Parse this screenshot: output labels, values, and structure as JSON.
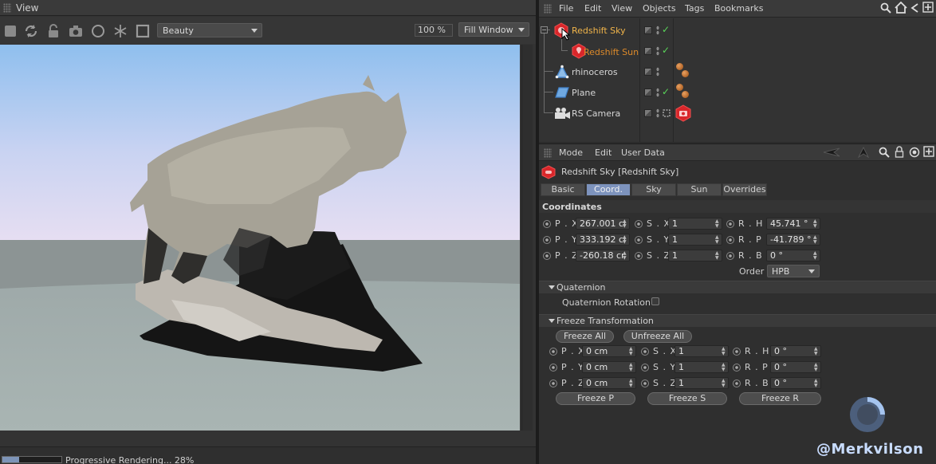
{
  "view": {
    "title": "View",
    "pass_dropdown": "Beauty",
    "zoom": "100 %",
    "fit_dropdown": "Fill Window",
    "status_text": "Progressive Rendering... 28%",
    "progress": 0.28
  },
  "object_manager": {
    "menu": [
      "File",
      "Edit",
      "View",
      "Objects",
      "Tags",
      "Bookmarks"
    ],
    "objects": [
      {
        "name": "Redshift Sky",
        "state": "selected"
      },
      {
        "name": "Redshift Sun",
        "state": "child"
      },
      {
        "name": "rhinoceros",
        "state": "normal"
      },
      {
        "name": "Plane",
        "state": "normal"
      },
      {
        "name": "RS Camera",
        "state": "normal"
      }
    ]
  },
  "attribute_manager": {
    "menu": [
      "Mode",
      "Edit",
      "User Data"
    ],
    "title": "Redshift Sky [Redshift Sky]",
    "tabs": [
      "Basic",
      "Coord.",
      "Sky",
      "Sun",
      "Overrides"
    ],
    "active_tab": "Coord.",
    "coordinates_header": "Coordinates",
    "labels": {
      "px": "P . X",
      "py": "P . Y",
      "pz": "P . Z",
      "sx": "S . X",
      "sy": "S . Y",
      "sz": "S . Z",
      "rh": "R . H",
      "rp": "R . P",
      "rb": "R . B",
      "order": "Order"
    },
    "coords": {
      "px": "267.001 ci",
      "py": "333.192 ci",
      "pz": "-260.18 cr",
      "sx": "1",
      "sy": "1",
      "sz": "1",
      "rh": "45.741 °",
      "rp": "-41.789 °",
      "rb": "0 °"
    },
    "order_value": "HPB",
    "quaternion_header": "Quaternion",
    "quaternion_rotation_label": "Quaternion Rotation",
    "freeze_header": "Freeze Transformation",
    "freeze_all": "Freeze All",
    "unfreeze_all": "Unfreeze All",
    "freeze_coords": {
      "px": "0 cm",
      "py": "0 cm",
      "pz": "0 cm",
      "sx": "1",
      "sy": "1",
      "sz": "1",
      "rh": "0 °",
      "rp": "0 °",
      "rb": "0 °"
    },
    "freeze_p": "Freeze P",
    "freeze_s": "Freeze S",
    "freeze_r": "Freeze R"
  },
  "watermark": "@Merkvilson",
  "colors": {
    "accent_tab": "#7d93bd",
    "selected_object": "#f0b44a",
    "redshift_red": "#d9262a"
  },
  "icons": [
    "stop-icon",
    "refresh-icon",
    "lock-icon",
    "camera-icon",
    "circle-icon",
    "snowflake-icon",
    "square-icon",
    "search-icon",
    "home-icon",
    "arrow-left-icon",
    "arrow-up-icon",
    "lock-icon",
    "target-icon",
    "expand-icon"
  ]
}
